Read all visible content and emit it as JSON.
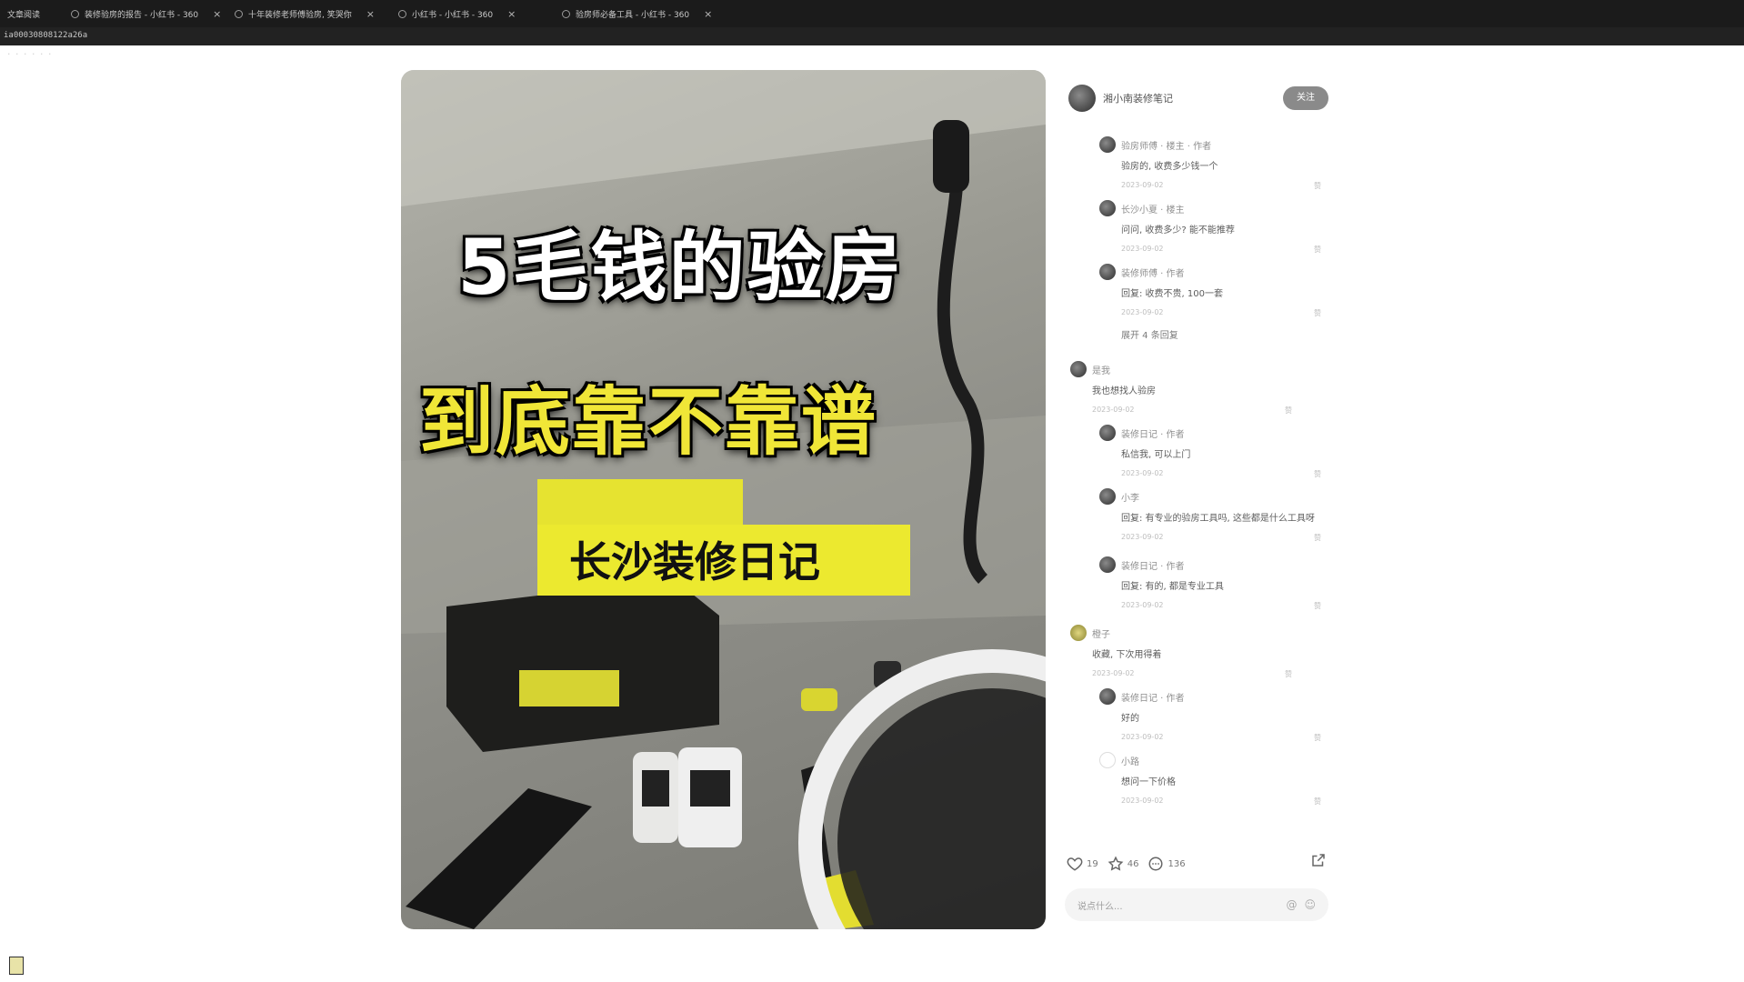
{
  "browser": {
    "tabs": [
      {
        "title": "文章阅读"
      },
      {
        "title": "装修验房的报告 - 小红书 - 360"
      },
      {
        "title": "十年装修老师傅验房, 笑哭你"
      },
      {
        "title": "小红书 - 小红书 - 360"
      },
      {
        "title": "验房师必备工具 - 小红书 - 360"
      }
    ],
    "close_glyph": "×",
    "address": "ia00030808122a26a",
    "bookmarks": "·  ·  ·  ·  ·  ·"
  },
  "post": {
    "cover": {
      "title_line1": "5毛钱的验房",
      "title_line2": "到底靠不靠谱",
      "tagline": "长沙装修日记"
    },
    "author": {
      "name": "湘小南装修笔记"
    },
    "follow_label": "关注",
    "comments": [
      {
        "name": "验房师傅 · 楼主 · 作者",
        "text": "验房的, 收费多少钱一个",
        "date": "2023-09-02",
        "likes": "赞"
      },
      {
        "name": "长沙小夏 · 楼主",
        "text": "问问, 收费多少? 能不能推荐",
        "date": "2023-09-02",
        "likes": "赞"
      },
      {
        "name": "装修师傅 · 作者",
        "text": "回复: 收费不贵, 100一套",
        "date": "2023-09-02",
        "likes": "赞"
      },
      {
        "name": "是我",
        "text": "我也想找人验房",
        "date": "2023-09-02",
        "likes": "赞"
      },
      {
        "name": "装修日记 · 作者",
        "text": "私信我, 可以上门",
        "date": "2023-09-02",
        "likes": "赞"
      },
      {
        "name": "小李",
        "text": "回复: 有专业的验房工具吗, 这些都是什么工具呀",
        "date": "2023-09-02",
        "likes": "赞"
      },
      {
        "name": "装修日记 · 作者",
        "text": "回复: 有的, 都是专业工具",
        "date": "2023-09-02",
        "likes": "赞"
      },
      {
        "name": "橙子",
        "text": "收藏, 下次用得着",
        "date": "2023-09-02",
        "likes": "赞"
      },
      {
        "name": "装修日记 · 作者",
        "text": "好的",
        "date": "2023-09-02",
        "likes": "赞"
      },
      {
        "name": "小路",
        "text": "想问一下价格",
        "date": "2023-09-02",
        "likes": "赞"
      }
    ],
    "more_replies": "展开 4 条回复",
    "actions": {
      "likes": "19",
      "collects": "46",
      "comments": "136"
    },
    "comment_placeholder": "说点什么..."
  }
}
